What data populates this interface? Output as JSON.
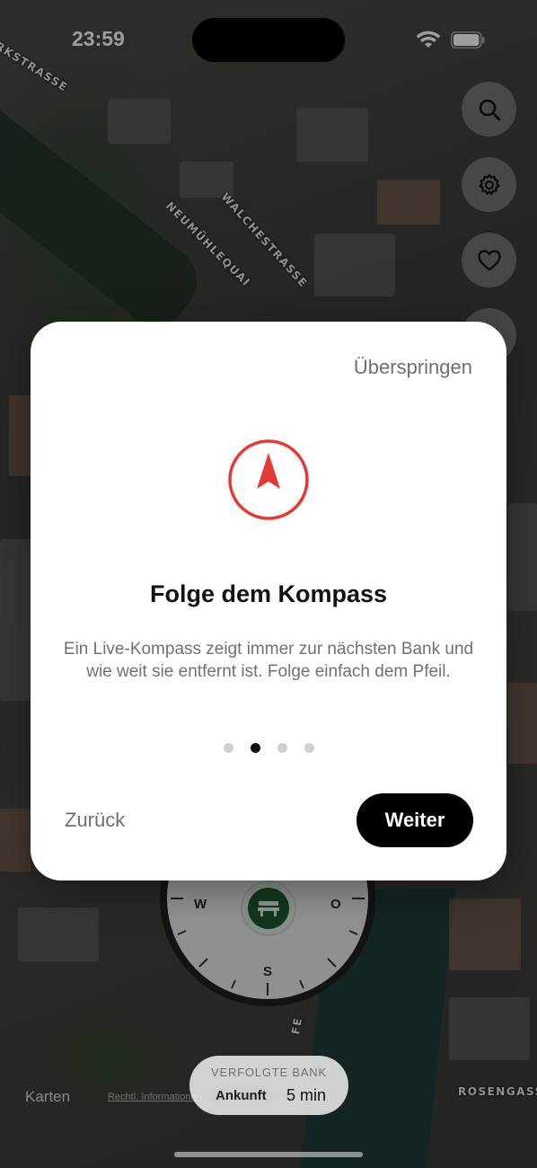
{
  "status_bar": {
    "time": "23:59",
    "wifi_icon": "wifi-icon",
    "battery_icon": "battery-icon"
  },
  "map": {
    "street_labels": [
      "RKSTRASSE",
      "NEUMÜHLEQUAI",
      "WALCHESTRASSE",
      "ROSENGASSE",
      "FE"
    ],
    "attribution": "Karten",
    "legal": "Rechtl. Informationen"
  },
  "floating_buttons": {
    "search_icon": "search-icon",
    "settings_icon": "gear-icon",
    "favorites_icon": "heart-icon",
    "location_icon": "location-arrow-icon"
  },
  "compass_widget": {
    "west": "W",
    "east": "O",
    "south": "S",
    "center_icon": "bench-icon"
  },
  "tracking": {
    "label": "VERFOLGTE BANK",
    "badge": "Ankunft",
    "time": "5 min"
  },
  "onboarding": {
    "skip_label": "Überspringen",
    "icon": "compass-arrow-icon",
    "title": "Folge dem Kompass",
    "body": "Ein Live-Kompass zeigt immer zur nächsten Bank und wie weit sie entfernt ist. Folge einfach dem Pfeil.",
    "page_count": 4,
    "current_page": 2,
    "back_label": "Zurück",
    "next_label": "Weiter"
  },
  "colors": {
    "accent_red": "#e53935",
    "button_black": "#000000",
    "bench_green": "#1d5a34"
  }
}
